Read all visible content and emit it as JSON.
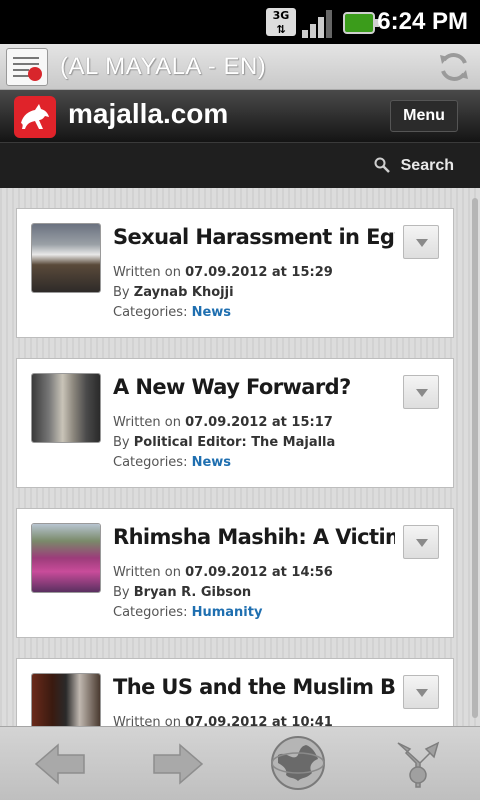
{
  "status_bar": {
    "network": "3G",
    "time": "6:24 PM"
  },
  "app_bar": {
    "title": "(AL MAYALA - EN)"
  },
  "site": {
    "name": "majalla.com",
    "menu_label": "Menu",
    "search_label": "Search"
  },
  "articles": [
    {
      "title": "Sexual Harassment in Egypt",
      "written_prefix": "Written on",
      "written": "07.09.2012 at 15:29",
      "by_prefix": "By",
      "author": "Zaynab Khojji",
      "categories_prefix": "Categories:",
      "category": "News"
    },
    {
      "title": "A New Way Forward?",
      "written_prefix": "Written on",
      "written": "07.09.2012 at 15:17",
      "by_prefix": "By",
      "author": "Political Editor: The Majalla",
      "categories_prefix": "Categories:",
      "category": "News"
    },
    {
      "title": "Rhimsha Mashih: A Victim ...",
      "written_prefix": "Written on",
      "written": "07.09.2012 at 14:56",
      "by_prefix": "By",
      "author": "Bryan R. Gibson",
      "categories_prefix": "Categories:",
      "category": "Humanity"
    },
    {
      "title": "The US and the Muslim Br...",
      "written_prefix": "Written on",
      "written": "07.09.2012 at 10:41"
    }
  ],
  "bottom_nav": {
    "icons": [
      "back-arrow-icon",
      "forward-arrow-icon",
      "globe-icon",
      "share-icon"
    ]
  },
  "colors": {
    "brand_red": "#e0232a",
    "category_link": "#1f6fb0",
    "header_dark": "#141414"
  }
}
